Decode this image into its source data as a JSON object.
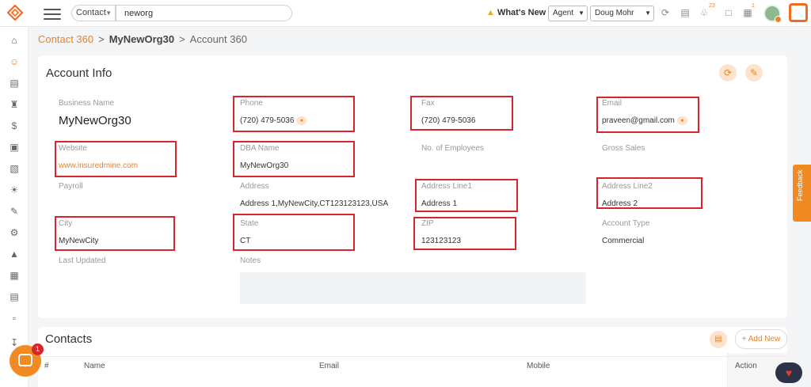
{
  "topbar": {
    "context_select": "Contact",
    "search_value": "neworg",
    "whats_new": "What's New",
    "role_select": "Agent",
    "user_select": "Doug Mohr",
    "notification_count": "23",
    "task_count": "1"
  },
  "breadcrumb": {
    "item1": "Contact 360",
    "sep1": ">",
    "item2": "MyNewOrg30",
    "sep2": ">",
    "item3": "Account 360"
  },
  "account_info": {
    "title": "Account Info",
    "fields": {
      "business_name": {
        "label": "Business Name",
        "value": "MyNewOrg30"
      },
      "phone": {
        "label": "Phone",
        "value": "(720) 479-5036"
      },
      "fax": {
        "label": "Fax",
        "value": "(720) 479-5036"
      },
      "email": {
        "label": "Email",
        "value": "praveen@gmail.com"
      },
      "website": {
        "label": "Website",
        "value": "www.insuredmine.com"
      },
      "dba_name": {
        "label": "DBA Name",
        "value": "MyNewOrg30"
      },
      "no_of_employees": {
        "label": "No. of Employees",
        "value": ""
      },
      "gross_sales": {
        "label": "Gross Sales",
        "value": ""
      },
      "payroll": {
        "label": "Payroll",
        "value": ""
      },
      "address": {
        "label": "Address",
        "value": "Address 1,MyNewCity,CT123123123,USA"
      },
      "address_line1": {
        "label": "Address Line1",
        "value": "Address 1"
      },
      "address_line2": {
        "label": "Address Line2",
        "value": "Address 2"
      },
      "city": {
        "label": "City",
        "value": "MyNewCity"
      },
      "state": {
        "label": "State",
        "value": "CT"
      },
      "zip": {
        "label": "ZIP",
        "value": "123123123"
      },
      "account_type": {
        "label": "Account Type",
        "value": "Commercial"
      },
      "last_updated": {
        "label": "Last Updated",
        "value": ""
      },
      "notes": {
        "label": "Notes",
        "value": ""
      }
    }
  },
  "contacts": {
    "title": "Contacts",
    "add_label": "+ Add New",
    "columns": [
      "#",
      "Name",
      "Email",
      "Mobile",
      "Action"
    ]
  },
  "feedback_label": "Feedback",
  "chat_badge": "1",
  "colors": {
    "accent": "#e8832a",
    "highlight": "#d6262b",
    "brand": "#f26b21"
  },
  "icons": [
    "logo-icon",
    "menu-icon",
    "sync-icon",
    "calendar-icon",
    "bell-icon",
    "chat-icon",
    "task-icon",
    "refresh-icon",
    "edit-icon",
    "heart-icon"
  ]
}
